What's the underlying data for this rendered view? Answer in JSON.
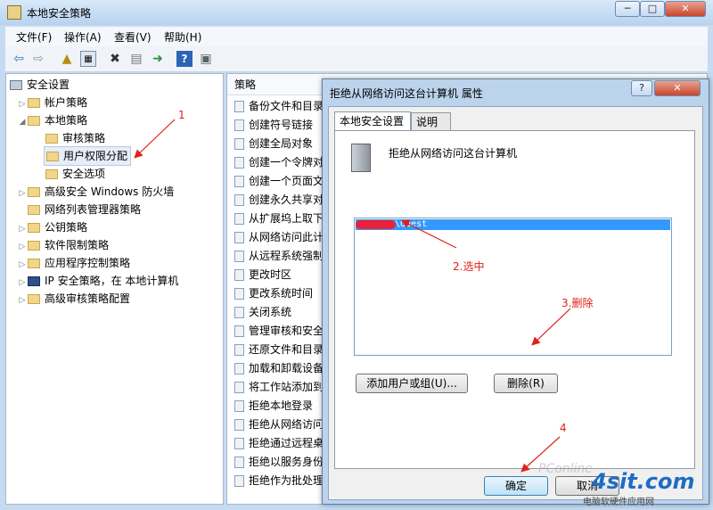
{
  "window": {
    "title": "本地安全策略",
    "minimize": "─",
    "maximize": "□",
    "close": "✕"
  },
  "menu": [
    "文件(F)",
    "操作(A)",
    "查看(V)",
    "帮助(H)"
  ],
  "tree": {
    "root": "安全设置",
    "items": [
      {
        "label": "帐户策略",
        "level": 1
      },
      {
        "label": "本地策略",
        "level": 1
      },
      {
        "label": "审核策略",
        "level": 2
      },
      {
        "label": "用户权限分配",
        "level": 2
      },
      {
        "label": "安全选项",
        "level": 2
      },
      {
        "label": "高级安全 Windows 防火墙",
        "level": 1
      },
      {
        "label": "网络列表管理器策略",
        "level": 1
      },
      {
        "label": "公钥策略",
        "level": 1
      },
      {
        "label": "软件限制策略",
        "level": 1
      },
      {
        "label": "应用程序控制策略",
        "level": 1
      },
      {
        "label": "IP 安全策略，在 本地计算机",
        "level": 1
      },
      {
        "label": "高级审核策略配置",
        "level": 1
      }
    ]
  },
  "policies": {
    "header": "策略",
    "items": [
      "备份文件和目录",
      "创建符号链接",
      "创建全局对象",
      "创建一个令牌对",
      "创建一个页面文",
      "创建永久共享对",
      "从扩展坞上取下",
      "从网络访问此计",
      "从远程系统强制",
      "更改时区",
      "更改系统时间",
      "关闭系统",
      "管理审核和安全",
      "还原文件和目录",
      "加载和卸载设备",
      "将工作站添加到",
      "拒绝本地登录",
      "拒绝从网络访问",
      "拒绝通过远程桌",
      "拒绝以服务身份",
      "拒绝作为批处理"
    ]
  },
  "dialog": {
    "title": "拒绝从网络访问这台计算机 属性",
    "help": "?",
    "close": "✕",
    "tabs": [
      "本地安全设置",
      "说明"
    ],
    "policy_name": "拒绝从网络访问这台计算机",
    "selected_user": "\\Guest",
    "add_button": "添加用户或组(U)...",
    "remove_button": "删除(R)",
    "ok_button": "确定",
    "cancel_button": "取消"
  },
  "annotations": {
    "a1": "1",
    "a2": "2.选中",
    "a3": "3.删除",
    "a4": "4",
    "color": "#e0201a"
  },
  "logo": {
    "main": "4sit.com",
    "sub": "电脑软硬件应用网"
  },
  "watermark": "PConline"
}
